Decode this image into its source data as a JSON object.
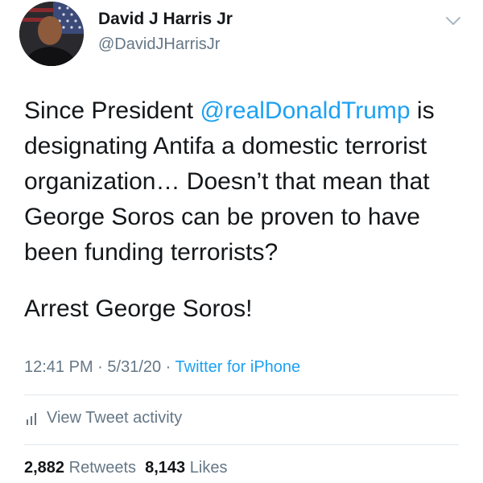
{
  "author": {
    "display_name": "David J Harris Jr",
    "handle": "@DavidJHarrisJr",
    "avatar_icon": "profile-photo"
  },
  "tweet": {
    "line1_prefix": "Since President ",
    "mention": "@realDonaldTrump",
    "line1_suffix": " is designating Antifa a domestic terrorist organization… Doesn’t that mean that George Soros can be proven to have been funding terrorists?",
    "paragraph2": "Arrest George Soros!"
  },
  "meta": {
    "time": "12:41 PM",
    "separator": " · ",
    "date": "5/31/20",
    "source": "Twitter for iPhone"
  },
  "activity": {
    "label": "View Tweet activity",
    "icon": "bar-chart-icon"
  },
  "stats": {
    "retweets_count": "2,882",
    "retweets_label": "Retweets",
    "likes_count": "8,143",
    "likes_label": "Likes"
  },
  "colors": {
    "link": "#1da1f2",
    "secondary_text": "#657786",
    "primary_text": "#14171a",
    "divider": "#e1e8ed"
  }
}
